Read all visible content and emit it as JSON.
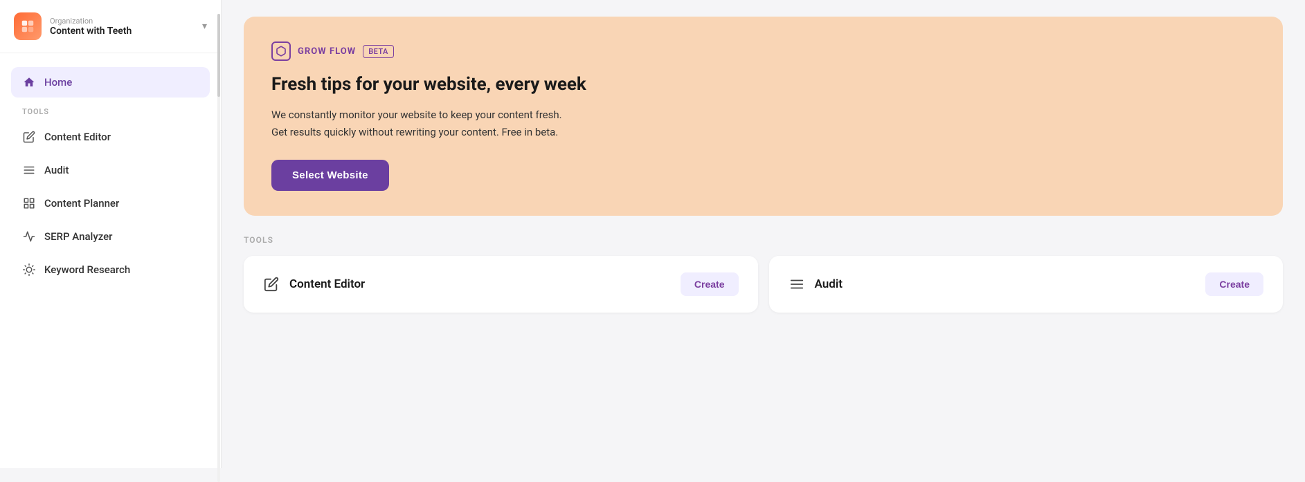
{
  "sidebar": {
    "organization_label": "Organization",
    "organization_name": "Content with Teeth",
    "nav": {
      "home_label": "Home"
    },
    "tools_section_label": "TOOLS",
    "tools": [
      {
        "id": "content-editor",
        "label": "Content Editor"
      },
      {
        "id": "audit",
        "label": "Audit"
      },
      {
        "id": "content-planner",
        "label": "Content Planner"
      },
      {
        "id": "serp-analyzer",
        "label": "SERP Analyzer"
      },
      {
        "id": "keyword-research",
        "label": "Keyword Research"
      }
    ]
  },
  "banner": {
    "grow_flow_label": "GROW FLOW",
    "beta_label": "BETA",
    "headline": "Fresh tips for your website, every week",
    "description_line1": "We constantly monitor your website to keep your content fresh.",
    "description_line2": "Get results quickly without rewriting your content. Free in beta.",
    "select_website_btn": "Select Website"
  },
  "main": {
    "tools_section_label": "TOOLS",
    "tool_cards": [
      {
        "id": "content-editor",
        "label": "Content Editor",
        "btn_label": "Create"
      },
      {
        "id": "audit",
        "label": "Audit",
        "btn_label": "Create"
      }
    ]
  },
  "colors": {
    "purple": "#6b3fa0",
    "banner_bg": "#f9d5b5",
    "nav_active_bg": "#f0eeff"
  }
}
